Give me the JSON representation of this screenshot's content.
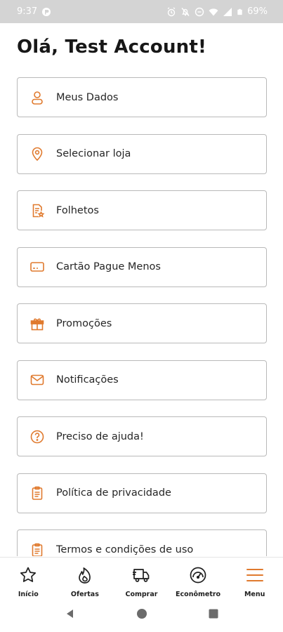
{
  "status_bar": {
    "time": "9:37",
    "battery": "69%",
    "icons": [
      "app-notification-icon",
      "alarm-off-icon",
      "notifications-off-icon",
      "do-not-disturb-icon",
      "wifi-icon",
      "signal-icon",
      "battery-icon"
    ]
  },
  "greeting": "Olá, Test Account!",
  "accent_color": "#e07a2e",
  "menu_items": [
    {
      "label": "Meus Dados",
      "icon": "user-icon"
    },
    {
      "label": "Selecionar loja",
      "icon": "location-pin-icon"
    },
    {
      "label": "Folhetos",
      "icon": "flyer-document-icon"
    },
    {
      "label": "Cartão Pague Menos",
      "icon": "card-icon"
    },
    {
      "label": "Promoções",
      "icon": "gift-icon"
    },
    {
      "label": "Notificações",
      "icon": "envelope-icon"
    },
    {
      "label": "Preciso de ajuda!",
      "icon": "help-icon"
    },
    {
      "label": "Política de privacidade",
      "icon": "clipboard-icon"
    },
    {
      "label": "Termos e condições de uso",
      "icon": "clipboard-icon"
    }
  ],
  "bottom_nav": [
    {
      "label": "Início",
      "icon": "star-icon"
    },
    {
      "label": "Ofertas",
      "icon": "flame-icon"
    },
    {
      "label": "Comprar",
      "icon": "delivery-truck-icon"
    },
    {
      "label": "Econômetro",
      "icon": "gauge-icon"
    },
    {
      "label": "Menu",
      "icon": "hamburger-menu-icon",
      "active": true
    }
  ]
}
